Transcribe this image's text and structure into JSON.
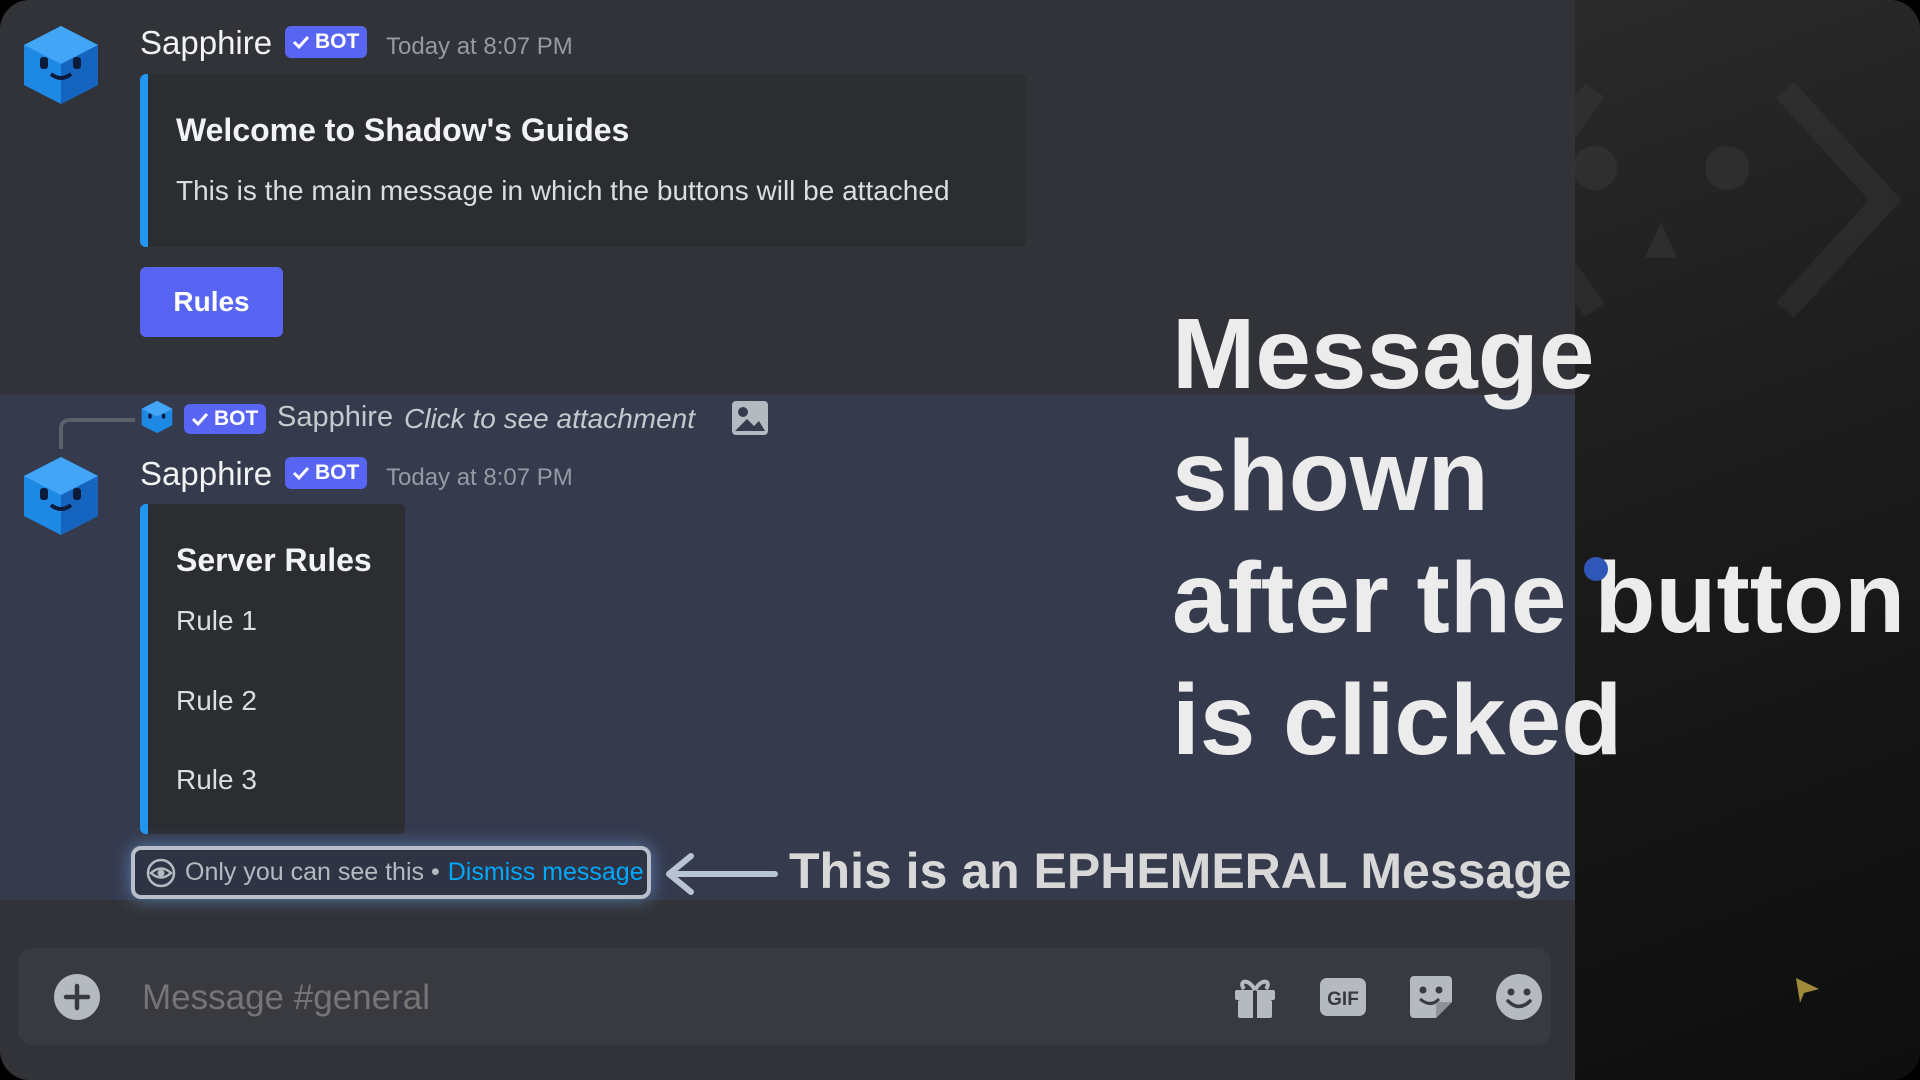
{
  "messages": [
    {
      "author": "Sapphire",
      "bot_label": "BOT",
      "timestamp": "Today at 8:07 PM",
      "embed": {
        "title": "Welcome to Shadow's Guides",
        "description": "This is the main message in which the buttons will be attached"
      },
      "button_label": "Rules"
    },
    {
      "reply": {
        "bot_label": "BOT",
        "author": "Sapphire",
        "text": "Click to see attachment"
      },
      "author": "Sapphire",
      "bot_label": "BOT",
      "timestamp": "Today at 8:07 PM",
      "embed": {
        "title": "Server Rules",
        "lines": [
          "Rule 1",
          "Rule 2",
          "Rule 3"
        ]
      },
      "ephemeral": {
        "notice": "Only you can see this •",
        "dismiss_label": "Dismiss message"
      }
    }
  ],
  "annotations": {
    "ephemeral_caption": "This is an EPHEMERAL Message",
    "overlay_caption": "Message shown\nafter the button\nis clicked"
  },
  "composer": {
    "placeholder": "Message #general",
    "tools": [
      "gift-icon",
      "gif-icon",
      "sticker-icon",
      "emoji-icon"
    ],
    "gif_label": "GIF"
  },
  "colors": {
    "accent": "#5865f2",
    "embed_border": "#2196f3",
    "link": "#00a8fc",
    "chat_bg": "#313338",
    "ephemeral_bg": "#353a4d"
  }
}
